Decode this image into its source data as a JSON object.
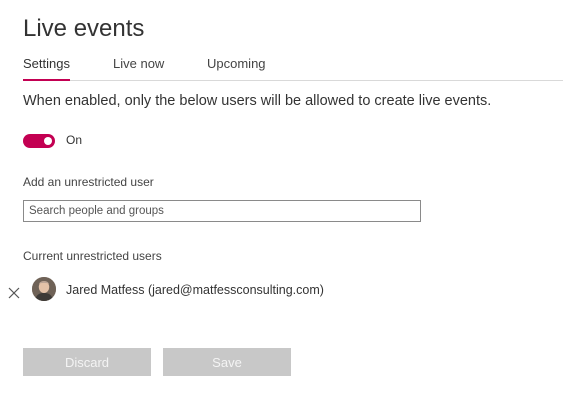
{
  "page": {
    "title": "Live events"
  },
  "tabs": [
    {
      "label": "Settings",
      "active": true
    },
    {
      "label": "Live now",
      "active": false
    },
    {
      "label": "Upcoming",
      "active": false
    }
  ],
  "description": "When enabled, only the below users will be allowed to create live events.",
  "toggle": {
    "state_label": "On",
    "enabled": true
  },
  "add_user": {
    "label": "Add an unrestricted user",
    "placeholder": "Search people and groups",
    "value": ""
  },
  "current_users": {
    "label": "Current unrestricted users",
    "items": [
      {
        "display": "Jared Matfess (jared@matfessconsulting.com)"
      }
    ]
  },
  "actions": {
    "discard_label": "Discard",
    "save_label": "Save"
  },
  "colors": {
    "accent": "#c30052",
    "disabled_button": "#c8c8c8"
  },
  "icons": {
    "remove": "close-icon",
    "avatar": "user-avatar"
  }
}
